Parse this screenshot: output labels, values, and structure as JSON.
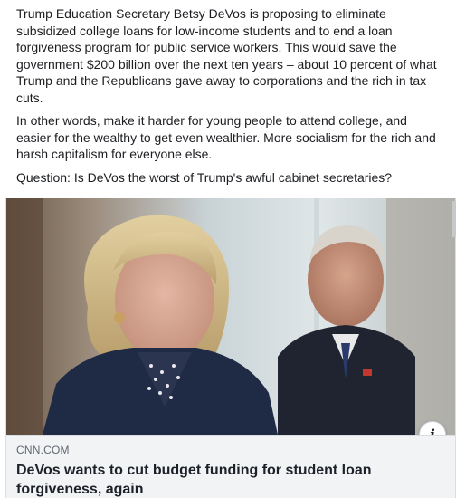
{
  "post": {
    "paragraphs": [
      "Trump Education Secretary Betsy DeVos is proposing to eliminate subsidized college loans for low-income students and to end a loan forgiveness program for public service workers. This would save the government $200 billion over the next ten years – about 10 percent of what Trump and the Republicans gave away to corporations and the rich in tax cuts.",
      "In other words, make it harder for young people to attend college, and easier for the wealthy to get even wealthier. More socialism for the rich and harsh capitalism for everyone else.",
      "Question: Is DeVos the worst of Trump's awful cabinet secretaries?"
    ]
  },
  "link_preview": {
    "domain": "CNN.COM",
    "title": "DeVos wants to cut budget funding for student loan forgiveness, again",
    "info_icon": "info-icon",
    "image": "photo-woman-blonde-hair-and-man-in-suit"
  }
}
